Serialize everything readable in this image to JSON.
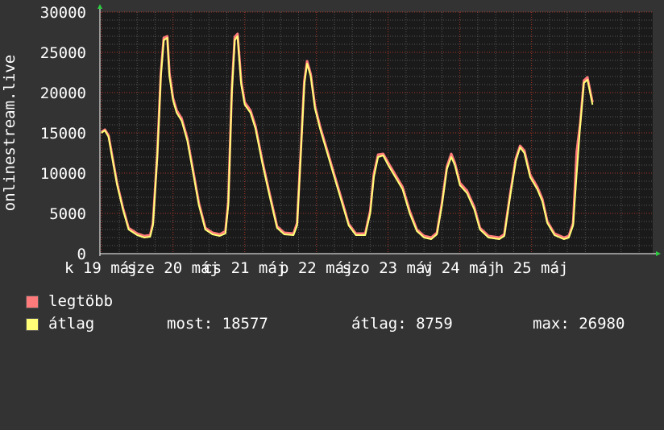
{
  "chart_data": {
    "type": "area",
    "ylabel": "onlinestream.live",
    "ylim": [
      0,
      30000
    ],
    "yticks": [
      "0",
      "5000",
      "10000",
      "15000",
      "20000",
      "25000",
      "30000"
    ],
    "xlim": [
      -0.02,
      7.69
    ],
    "xticks": [
      {
        "x": 0,
        "label": "k 19 máj"
      },
      {
        "x": 1,
        "label": "sze 20 máj"
      },
      {
        "x": 2,
        "label": "cs 21 máj"
      },
      {
        "x": 3,
        "label": "p 22 máj"
      },
      {
        "x": 4,
        "label": "szo 23 máj"
      },
      {
        "x": 5,
        "label": "v 24 máj"
      },
      {
        "x": 6,
        "label": "h 25 máj"
      }
    ],
    "colors": {
      "max": "#ff7b7b",
      "avg": "#ffff77",
      "avg_line": "#ffd966",
      "background": "#333333",
      "plot_background": "#1a1a1a",
      "grid_major": "#c0392b",
      "grid_minor": "#555555",
      "arrow": "#2ecc40"
    },
    "series": [
      {
        "name": "átlag",
        "points": [
          [
            0,
            15000
          ],
          [
            0.05,
            15300
          ],
          [
            0.1,
            14500
          ],
          [
            0.15,
            12000
          ],
          [
            0.22,
            8500
          ],
          [
            0.3,
            5500
          ],
          [
            0.38,
            3000
          ],
          [
            0.5,
            2300
          ],
          [
            0.6,
            2000
          ],
          [
            0.68,
            2100
          ],
          [
            0.72,
            3500
          ],
          [
            0.78,
            12000
          ],
          [
            0.83,
            22000
          ],
          [
            0.87,
            26500
          ],
          [
            0.92,
            26800
          ],
          [
            0.95,
            22000
          ],
          [
            1.0,
            19000
          ],
          [
            1.05,
            17500
          ],
          [
            1.12,
            16500
          ],
          [
            1.2,
            14000
          ],
          [
            1.28,
            10000
          ],
          [
            1.36,
            6000
          ],
          [
            1.45,
            3000
          ],
          [
            1.55,
            2400
          ],
          [
            1.65,
            2200
          ],
          [
            1.73,
            2500
          ],
          [
            1.77,
            6000
          ],
          [
            1.82,
            20000
          ],
          [
            1.86,
            26500
          ],
          [
            1.9,
            27000
          ],
          [
            1.95,
            21000
          ],
          [
            2.0,
            18500
          ],
          [
            2.08,
            17500
          ],
          [
            2.15,
            15500
          ],
          [
            2.25,
            11000
          ],
          [
            2.35,
            7000
          ],
          [
            2.45,
            3200
          ],
          [
            2.55,
            2400
          ],
          [
            2.68,
            2300
          ],
          [
            2.73,
            3500
          ],
          [
            2.78,
            12000
          ],
          [
            2.83,
            21000
          ],
          [
            2.87,
            23600
          ],
          [
            2.92,
            22000
          ],
          [
            2.98,
            18000
          ],
          [
            3.05,
            15500
          ],
          [
            3.15,
            12500
          ],
          [
            3.25,
            9500
          ],
          [
            3.35,
            6500
          ],
          [
            3.45,
            3500
          ],
          [
            3.55,
            2300
          ],
          [
            3.68,
            2300
          ],
          [
            3.75,
            5000
          ],
          [
            3.8,
            9500
          ],
          [
            3.86,
            12000
          ],
          [
            3.93,
            12200
          ],
          [
            4.0,
            11000
          ],
          [
            4.1,
            9500
          ],
          [
            4.2,
            8000
          ],
          [
            4.3,
            5000
          ],
          [
            4.4,
            2800
          ],
          [
            4.5,
            2000
          ],
          [
            4.6,
            1800
          ],
          [
            4.68,
            2400
          ],
          [
            4.75,
            6000
          ],
          [
            4.82,
            10500
          ],
          [
            4.88,
            12000
          ],
          [
            4.93,
            11000
          ],
          [
            5.0,
            8500
          ],
          [
            5.1,
            7500
          ],
          [
            5.2,
            5500
          ],
          [
            5.28,
            3000
          ],
          [
            5.4,
            2000
          ],
          [
            5.55,
            1800
          ],
          [
            5.62,
            2200
          ],
          [
            5.7,
            7000
          ],
          [
            5.78,
            11500
          ],
          [
            5.84,
            13200
          ],
          [
            5.9,
            12500
          ],
          [
            5.98,
            9500
          ],
          [
            6.08,
            8000
          ],
          [
            6.15,
            6500
          ],
          [
            6.22,
            3800
          ],
          [
            6.32,
            2300
          ],
          [
            6.45,
            1800
          ],
          [
            6.52,
            2000
          ],
          [
            6.58,
            3500
          ],
          [
            6.63,
            10000
          ],
          [
            6.68,
            16000
          ],
          [
            6.73,
            21200
          ],
          [
            6.78,
            21600
          ],
          [
            6.85,
            18500
          ]
        ]
      },
      {
        "name": "legtöbb",
        "points": [
          [
            0,
            15100
          ],
          [
            0.05,
            15400
          ],
          [
            0.1,
            14700
          ],
          [
            0.15,
            12200
          ],
          [
            0.22,
            8700
          ],
          [
            0.3,
            5700
          ],
          [
            0.38,
            3200
          ],
          [
            0.5,
            2500
          ],
          [
            0.6,
            2200
          ],
          [
            0.68,
            2300
          ],
          [
            0.72,
            3800
          ],
          [
            0.78,
            12400
          ],
          [
            0.83,
            22400
          ],
          [
            0.87,
            26800
          ],
          [
            0.92,
            27000
          ],
          [
            0.95,
            22400
          ],
          [
            1.0,
            19300
          ],
          [
            1.05,
            17800
          ],
          [
            1.12,
            16800
          ],
          [
            1.2,
            14300
          ],
          [
            1.28,
            10300
          ],
          [
            1.36,
            6300
          ],
          [
            1.45,
            3200
          ],
          [
            1.55,
            2600
          ],
          [
            1.65,
            2400
          ],
          [
            1.73,
            2800
          ],
          [
            1.77,
            6500
          ],
          [
            1.82,
            20400
          ],
          [
            1.86,
            26900
          ],
          [
            1.9,
            27300
          ],
          [
            1.95,
            21400
          ],
          [
            2.0,
            18800
          ],
          [
            2.08,
            17800
          ],
          [
            2.15,
            15800
          ],
          [
            2.25,
            11300
          ],
          [
            2.35,
            7300
          ],
          [
            2.45,
            3400
          ],
          [
            2.55,
            2600
          ],
          [
            2.68,
            2500
          ],
          [
            2.73,
            3800
          ],
          [
            2.78,
            12400
          ],
          [
            2.83,
            21400
          ],
          [
            2.87,
            23900
          ],
          [
            2.92,
            22300
          ],
          [
            2.98,
            18300
          ],
          [
            3.05,
            15800
          ],
          [
            3.15,
            12800
          ],
          [
            3.25,
            9800
          ],
          [
            3.35,
            6800
          ],
          [
            3.45,
            3700
          ],
          [
            3.55,
            2500
          ],
          [
            3.68,
            2500
          ],
          [
            3.75,
            5300
          ],
          [
            3.8,
            9900
          ],
          [
            3.86,
            12300
          ],
          [
            3.93,
            12400
          ],
          [
            4.0,
            11300
          ],
          [
            4.1,
            9800
          ],
          [
            4.2,
            8300
          ],
          [
            4.3,
            5300
          ],
          [
            4.4,
            3000
          ],
          [
            4.5,
            2200
          ],
          [
            4.6,
            2000
          ],
          [
            4.68,
            2600
          ],
          [
            4.75,
            6300
          ],
          [
            4.82,
            10800
          ],
          [
            4.88,
            12400
          ],
          [
            4.93,
            11300
          ],
          [
            5.0,
            8800
          ],
          [
            5.1,
            7800
          ],
          [
            5.2,
            5800
          ],
          [
            5.28,
            3200
          ],
          [
            5.4,
            2200
          ],
          [
            5.55,
            2000
          ],
          [
            5.62,
            2400
          ],
          [
            5.7,
            7300
          ],
          [
            5.78,
            11800
          ],
          [
            5.84,
            13400
          ],
          [
            5.9,
            12800
          ],
          [
            5.98,
            9800
          ],
          [
            6.08,
            8300
          ],
          [
            6.15,
            6800
          ],
          [
            6.22,
            4000
          ],
          [
            6.32,
            2500
          ],
          [
            6.45,
            2000
          ],
          [
            6.52,
            2200
          ],
          [
            6.58,
            3800
          ],
          [
            6.63,
            12700
          ],
          [
            6.68,
            16300
          ],
          [
            6.73,
            21500
          ],
          [
            6.78,
            21900
          ],
          [
            6.85,
            18800
          ]
        ]
      }
    ]
  },
  "legend": {
    "max_label": "legtöbb",
    "avg_label": "átlag",
    "current": "most: 18577",
    "average": "átlag: 8759",
    "maximum": "max: 26980"
  }
}
